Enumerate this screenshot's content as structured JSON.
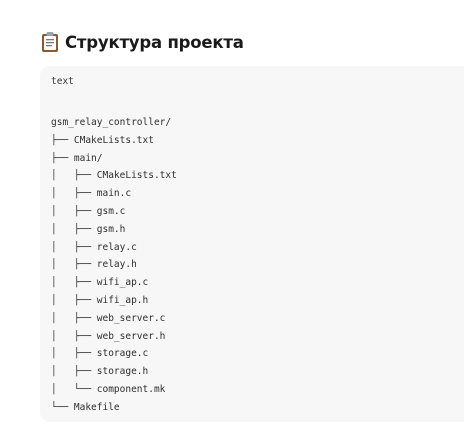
{
  "heading": {
    "icon": "clipboard-icon",
    "title": "Структура проекта"
  },
  "code_block": {
    "language": "text",
    "lines": [
      "gsm_relay_controller/",
      "├── CMakeLists.txt",
      "├── main/",
      "│   ├── CMakeLists.txt",
      "│   ├── main.c",
      "│   ├── gsm.c",
      "│   ├── gsm.h",
      "│   ├── relay.c",
      "│   ├── relay.h",
      "│   ├── wifi_ap.c",
      "│   ├── wifi_ap.h",
      "│   ├── web_server.c",
      "│   ├── web_server.h",
      "│   ├── storage.c",
      "│   ├── storage.h",
      "│   └── component.mk",
      "└── Makefile"
    ]
  }
}
